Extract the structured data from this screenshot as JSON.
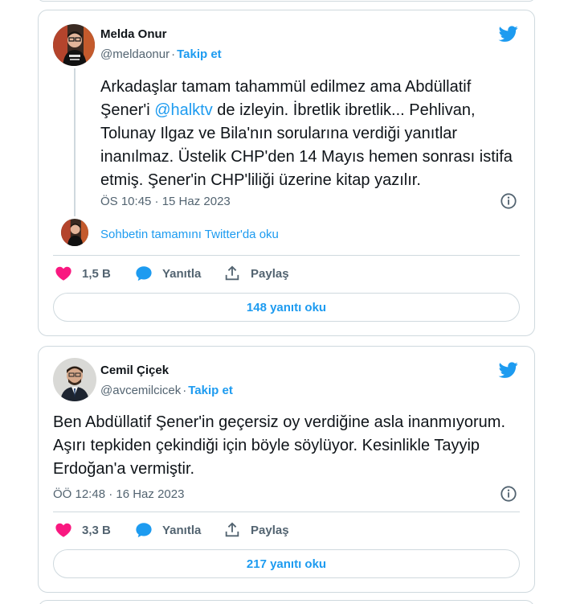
{
  "tweets": [
    {
      "author_name": "Melda Onur",
      "handle": "@meldaonur",
      "follow_label": "Takip et",
      "text_before": "Arkadaşlar tamam tahammül edilmez ama Abdüllatif Şener'i ",
      "mention": "@halktv",
      "text_after": " de izleyin. İbretlik ibretlik... Pehlivan, Tolunay Ilgaz ve Bila'nın sorularına verdiği yanıtlar inanılmaz. Üstelik CHP'den 14 Mayıs hemen sonrası istifa etmiş. Şener'in CHP'liliği üzerine kitap yazılır.",
      "timestamp": "ÖS 10:45 · 15 Haz 2023",
      "read_thread_label": "Sohbetin tamamını Twitter'da oku",
      "likes": "1,5 B",
      "reply_label": "Yanıtla",
      "share_label": "Paylaş",
      "replies_button": "148 yanıtı oku"
    },
    {
      "author_name": "Cemil Çiçek",
      "handle": "@avcemilcicek",
      "follow_label": "Takip et",
      "text": "Ben Abdüllatif Şener'in geçersiz oy verdiğine asla inanmıyorum. Aşırı tepkiden çekindiği için böyle söylüyor. Kesinlikle Tayyip Erdoğan'a vermiştir.",
      "timestamp": "ÖÖ 12:48 · 16 Haz 2023",
      "likes": "3,3 B",
      "reply_label": "Yanıtla",
      "share_label": "Paylaş",
      "replies_button": "217 yanıtı oku"
    }
  ],
  "icons": {
    "brand": "twitter-bird-icon",
    "like": "heart-icon",
    "reply": "speech-bubble-icon",
    "share": "share-upload-icon",
    "info": "info-icon"
  },
  "colors": {
    "accent": "#1d9bf0",
    "like": "#f91880",
    "text": "#0f1419",
    "muted": "#536471",
    "border": "#cfd9de"
  }
}
